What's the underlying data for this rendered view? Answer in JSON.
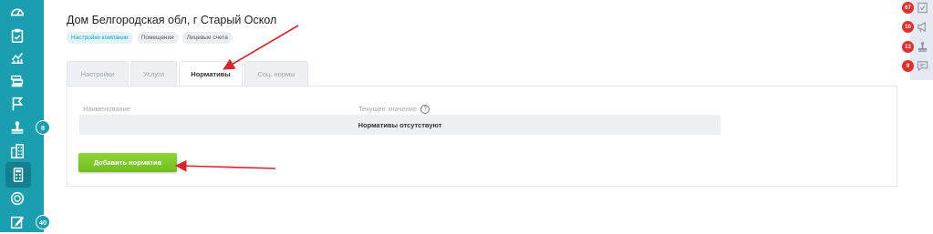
{
  "sidebar": {
    "items": [
      {
        "icon": "gauge-icon"
      },
      {
        "icon": "clipboard-icon"
      },
      {
        "icon": "chart-icon"
      },
      {
        "icon": "layers-icon"
      },
      {
        "icon": "flag-icon"
      },
      {
        "icon": "stamp-icon",
        "badge": "8"
      },
      {
        "icon": "building-icon"
      },
      {
        "icon": "calculator-icon",
        "active": true
      },
      {
        "icon": "coin-icon"
      },
      {
        "icon": "edit-icon",
        "badge": "40"
      }
    ]
  },
  "right_panel": {
    "items": [
      {
        "badge": "67",
        "icon": "document-icon"
      },
      {
        "badge": "10",
        "icon": "megaphone-icon"
      },
      {
        "badge": "13",
        "icon": "stamp-icon"
      },
      {
        "badge": "9",
        "icon": "chat-icon"
      }
    ]
  },
  "header": {
    "title": "Дом Белгородская обл, г Старый Оскол",
    "chips": [
      "Настройки компании",
      "Помещения",
      "Лицевые счета"
    ]
  },
  "tabs": [
    {
      "label": "Настройки"
    },
    {
      "label": "Услуги"
    },
    {
      "label": "Нормативы",
      "active": true
    },
    {
      "label": "Соц. нормы"
    }
  ],
  "table": {
    "columns": [
      "Наименование",
      "Текущее значение"
    ],
    "empty_message": "Нормативы отсутствуют"
  },
  "add_button_label": "Добавить норматив",
  "colors": {
    "sidebar": "#1b9fb0",
    "accent_green": "#7cc828",
    "badge_red": "#e0302e",
    "arrow_red": "#d8242a"
  }
}
